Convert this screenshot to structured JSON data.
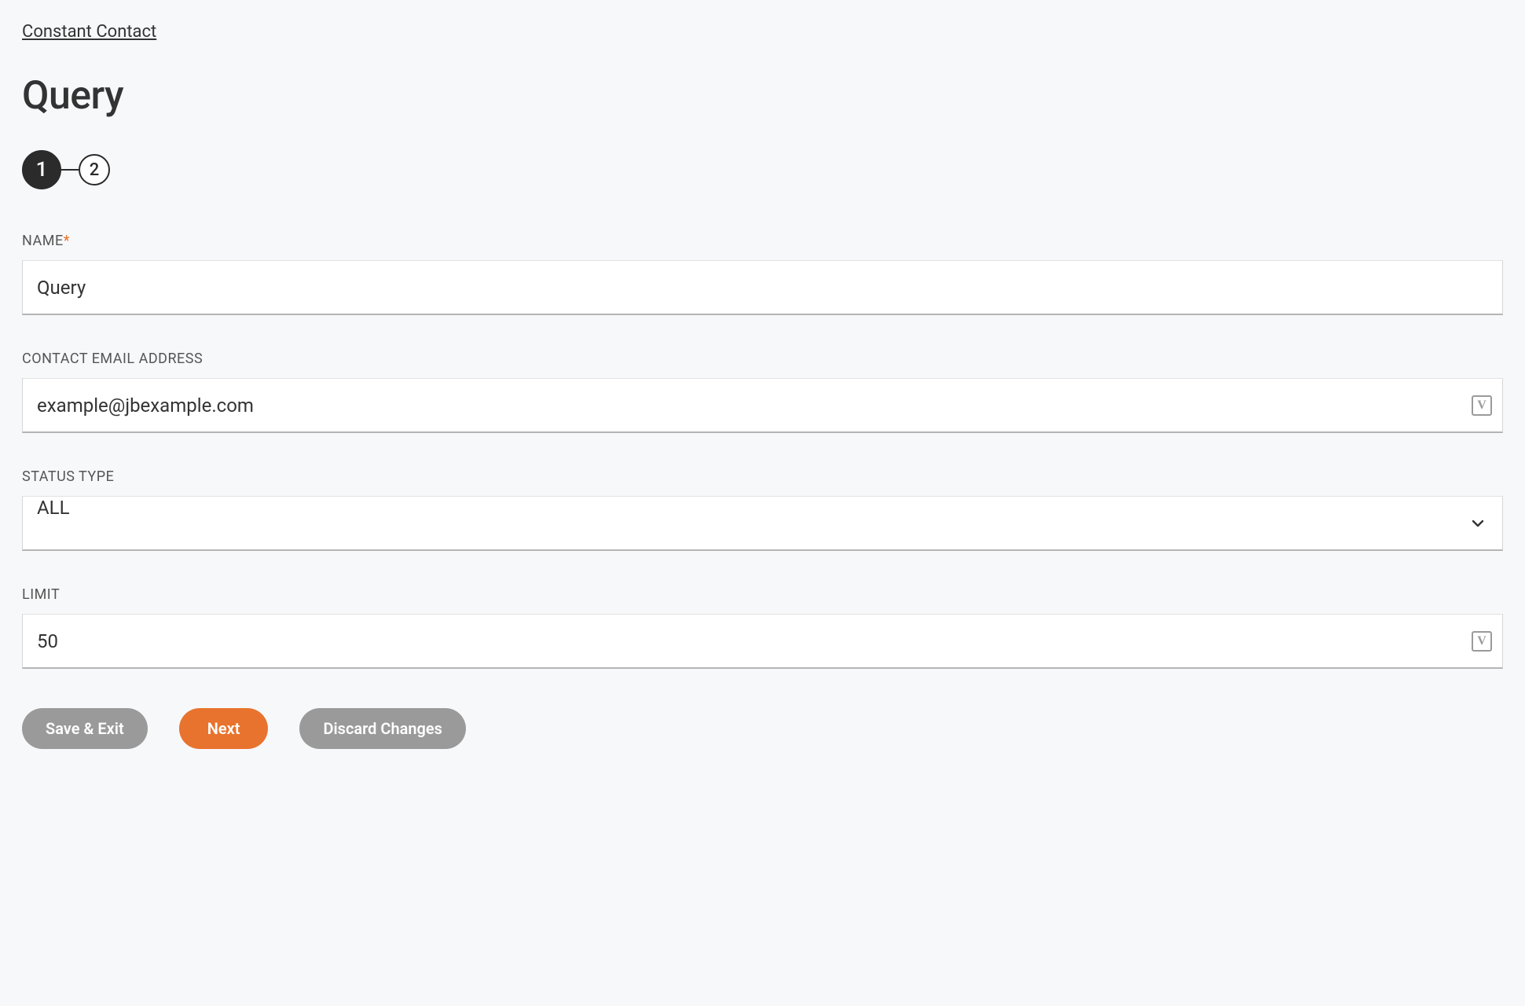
{
  "breadcrumb": "Constant Contact",
  "page_title": "Query",
  "stepper": {
    "current": "1",
    "next": "2"
  },
  "fields": {
    "name": {
      "label": "NAME",
      "required_mark": "*",
      "value": "Query"
    },
    "email": {
      "label": "CONTACT EMAIL ADDRESS",
      "value": "example@jbexample.com",
      "badge": "V"
    },
    "status": {
      "label": "STATUS TYPE",
      "value": "ALL"
    },
    "limit": {
      "label": "LIMIT",
      "value": "50",
      "badge": "V"
    }
  },
  "buttons": {
    "save_exit": "Save & Exit",
    "next": "Next",
    "discard": "Discard Changes"
  }
}
